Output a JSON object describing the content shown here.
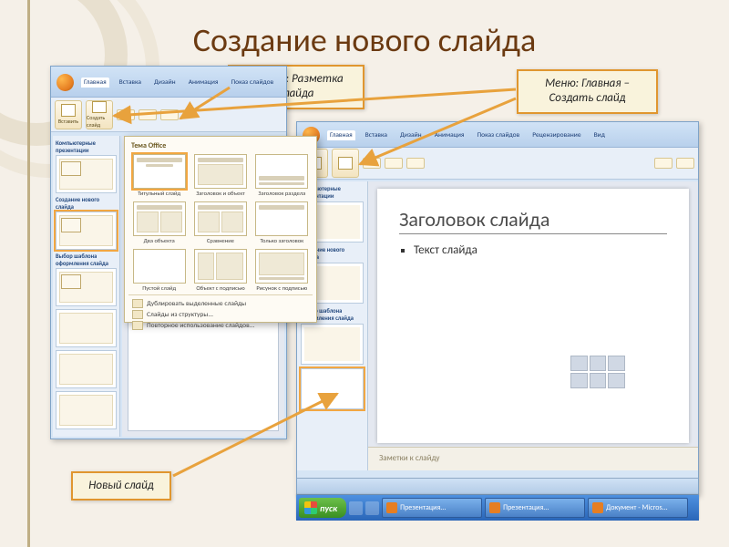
{
  "title": "Создание нового слайда",
  "callouts": {
    "layout": "Панель: Разметка слайда",
    "menu": "Меню: Главная – Создать слайд",
    "new": "Новый слайд"
  },
  "ribbon_tabs": [
    "Главная",
    "Вставка",
    "Дизайн",
    "Анимация",
    "Показ слайдов",
    "Рецензирование",
    "Вид"
  ],
  "tools": {
    "paste": "Вставить",
    "newslide": "Создать слайд"
  },
  "layout_panel": {
    "theme": "Тема Office",
    "layouts": [
      "Титульный слайд",
      "Заголовок и объект",
      "Заголовок раздела",
      "Два объекта",
      "Сравнение",
      "Только заголовок",
      "Пустой слайд",
      "Объект с подписью",
      "Рисунок с подписью"
    ],
    "extras": [
      "Дублировать выделенные слайды",
      "Слайды из структуры...",
      "Повторное использование слайдов..."
    ]
  },
  "left_thumbs": {
    "sec1": "Компьютерные презентации",
    "sec2": "Создание нового слайда",
    "sec3": "Выбор шаблона оформления слайда"
  },
  "slide": {
    "title": "Заголовок слайда",
    "bullet": "Текст слайда"
  },
  "notes": "Заметки к слайду",
  "right_thumbs": {
    "t1": "Компьютерные презентации",
    "t2": "Создание нового слайда",
    "t3": "Выбор шаблона оформления слайда"
  },
  "taskbar": {
    "start": "пуск",
    "items": [
      "Презентация...",
      "Презентация...",
      "Документ - Micros..."
    ]
  }
}
